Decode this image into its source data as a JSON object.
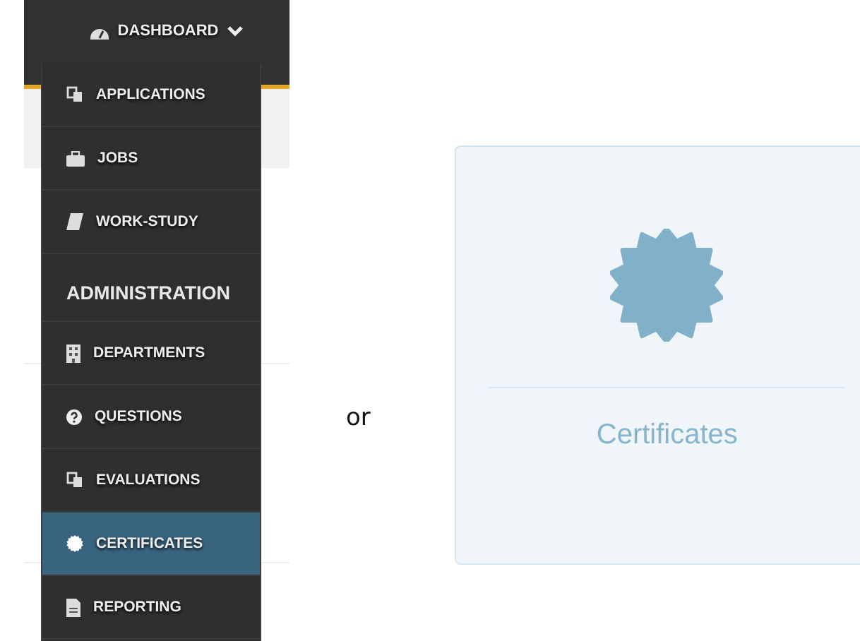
{
  "top_nav": {
    "label": "DASHBOARD"
  },
  "menu": [
    {
      "kind": "item",
      "label": "APPLICATIONS",
      "selected": false
    },
    {
      "kind": "item",
      "label": "JOBS",
      "selected": false
    },
    {
      "kind": "item",
      "label": "WORK-STUDY",
      "selected": false
    },
    {
      "kind": "header",
      "label": "ADMINISTRATION"
    },
    {
      "kind": "item",
      "label": "DEPARTMENTS",
      "selected": false
    },
    {
      "kind": "item",
      "label": "QUESTIONS",
      "selected": false
    },
    {
      "kind": "item",
      "label": "EVALUATIONS",
      "selected": false
    },
    {
      "kind": "item",
      "label": "CERTIFICATES",
      "selected": true
    },
    {
      "kind": "item",
      "label": "REPORTING",
      "selected": false
    }
  ],
  "separator_text": "or",
  "card": {
    "label": "Certificates"
  }
}
